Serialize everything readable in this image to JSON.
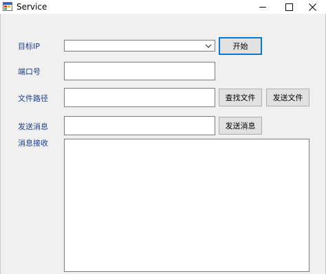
{
  "window": {
    "title": "Service",
    "icon": "app-window-icon",
    "controls": {
      "minimize": "minimize-icon",
      "maximize": "maximize-icon",
      "close": "close-icon"
    }
  },
  "form": {
    "target_ip_label": "目标IP",
    "target_ip_value": "",
    "start_button": "开始",
    "port_label": "端口号",
    "port_value": "",
    "file_path_label": "文件路径",
    "file_path_value": "",
    "find_file_button": "查找文件",
    "send_file_button": "发送文件",
    "send_message_label": "发送消息",
    "send_message_value": "",
    "send_message_button": "发送消息",
    "receive_label": "消息接收",
    "receive_value": ""
  }
}
